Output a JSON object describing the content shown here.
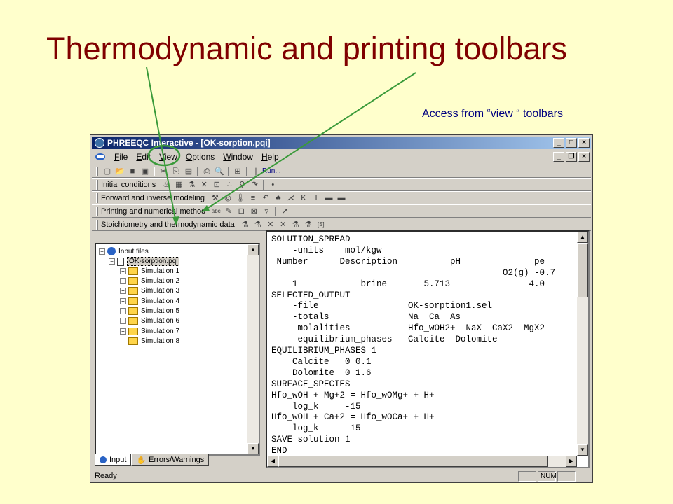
{
  "slide": {
    "title": "Thermodynamic and printing toolbars",
    "subtitle": "Access from “view “ toolbars"
  },
  "window": {
    "title": "PHREEQC Interactive - [OK-sorption.pqi]",
    "minimize": "_",
    "maximize": "□",
    "close": "×",
    "restore": "❐"
  },
  "menu": [
    "File",
    "Edit",
    "View",
    "Options",
    "Window",
    "Help"
  ],
  "toolbars": {
    "standard": {
      "run_label": "Run..."
    },
    "initial": "Initial conditions",
    "forward": "Forward and inverse modeling",
    "printing": "Printing and numerical method",
    "stoich": "Stoichiometry and thermodynamic data"
  },
  "tree": {
    "root": "Input files",
    "file": "OK-sorption.pqi",
    "simulations": [
      "Simulation 1",
      "Simulation 2",
      "Simulation 3",
      "Simulation 4",
      "Simulation 5",
      "Simulation 6",
      "Simulation 7",
      "Simulation 8"
    ]
  },
  "tabs": {
    "input": "Input",
    "errors": "Errors/Warnings"
  },
  "editor_lines": [
    "SOLUTION_SPREAD",
    "    -units    mol/kgw",
    " Number      Description          pH              pe",
    "                                            O2(g) -0.7",
    "    1            brine       5.713               4.0",
    "SELECTED_OUTPUT",
    "    -file                 OK-sorption1.sel",
    "    -totals               Na  Ca  As",
    "    -molalities           Hfo_wOH2+  NaX  CaX2  MgX2",
    "    -equilibrium_phases   Calcite  Dolomite",
    "EQUILIBRIUM_PHASES 1",
    "    Calcite   0 0.1",
    "    Dolomite  0 1.6",
    "SURFACE_SPECIES",
    "Hfo_wOH + Mg+2 = Hfo_wOMg+ + H+",
    "    log_k     -15",
    "Hfo_wOH + Ca+2 = Hfo_wOCa+ + H+",
    "    log_k     -15",
    "SAVE solution 1",
    "END"
  ],
  "status": {
    "left": "Ready",
    "num": "NUM"
  },
  "colors": {
    "title": "#800000",
    "subtitle": "#000080",
    "background": "#ffffcc",
    "arrows": "#3a9a3a"
  }
}
